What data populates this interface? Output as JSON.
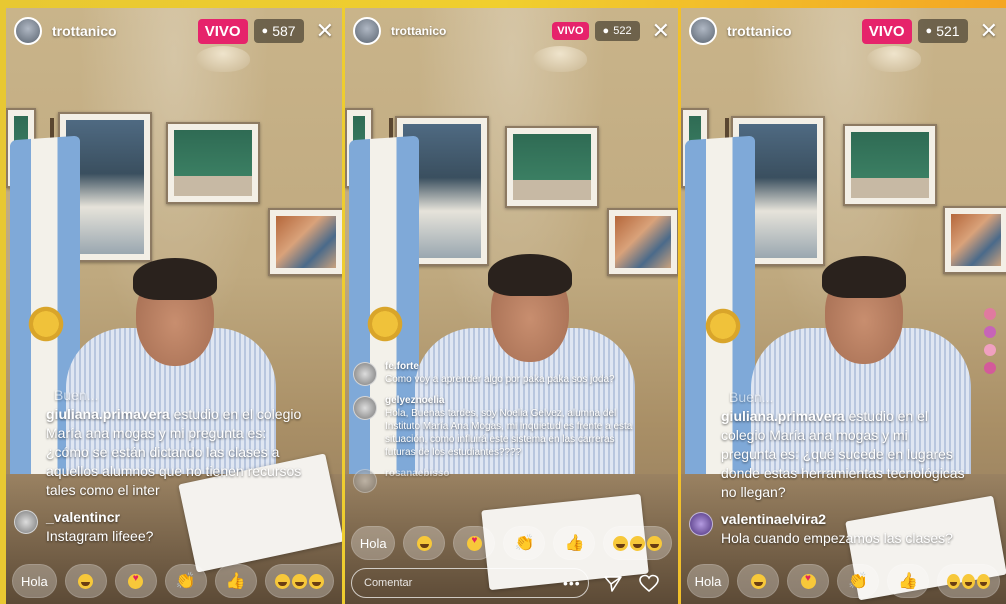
{
  "streams": [
    {
      "username": "trottanico",
      "live_label": "VIVO",
      "viewer_count": "587",
      "comments": [
        {
          "user": "",
          "text": "Buen...",
          "faded": true
        },
        {
          "user": "giuliana.primavera",
          "text": "estudio en el colegio María ana mogas y mi pregunta es: ¿cómo se están dictando las clases a aquellos alumnos que no tienen recursos tales como el inter"
        },
        {
          "user": "_valentincr",
          "text": "Instagram lifeee?"
        }
      ],
      "reactions": [
        "Hola",
        "laugh-emoji",
        "heart-eyes-emoji",
        "clap-emoji",
        "thumbs-up-emoji",
        "triple-laugh-emoji"
      ]
    },
    {
      "username": "trottanico",
      "live_label": "VIVO",
      "viewer_count": "522",
      "comments": [
        {
          "user": "fe.forte",
          "text": "Como voy a aprender algo por paka paka sos joda?"
        },
        {
          "user": "gelyeznoelia",
          "text": "Hola, Buenas tardes, soy Noelia Gelvez, alumna del Instituto María Ana Mogas, mi inquietud es frente a esta situación, como influirá este sistema en las carreras futuras de los estudiantes????"
        },
        {
          "user": "rosanaebisso",
          "text": "",
          "faded": true
        }
      ],
      "reactions": [
        "Hola",
        "laugh-emoji",
        "heart-eyes-emoji",
        "clap-emoji",
        "thumbs-up-emoji",
        "triple-laugh-emoji"
      ],
      "comment_placeholder": "Comentar"
    },
    {
      "username": "trottanico",
      "live_label": "VIVO",
      "viewer_count": "521",
      "comments": [
        {
          "user": "",
          "text": "Buen...",
          "faded": true
        },
        {
          "user": "giuliana.primavera",
          "text": "estudio en el colegio María ana mogas y mi pregunta es: ¿qué sucede en lugares donde estas herramientas tecnológicas no llegan?"
        },
        {
          "user": "valentinaelvira2",
          "text": "Hola cuando empezamos las clases?"
        }
      ],
      "reactions": [
        "Hola",
        "laugh-emoji",
        "heart-eyes-emoji",
        "clap-emoji",
        "thumbs-up-emoji",
        "triple-laugh-emoji"
      ]
    }
  ],
  "colors": {
    "live_badge": "#e6236b",
    "border_yellow": "#f0cf2e",
    "flag_blue": "#7fa9d8"
  }
}
